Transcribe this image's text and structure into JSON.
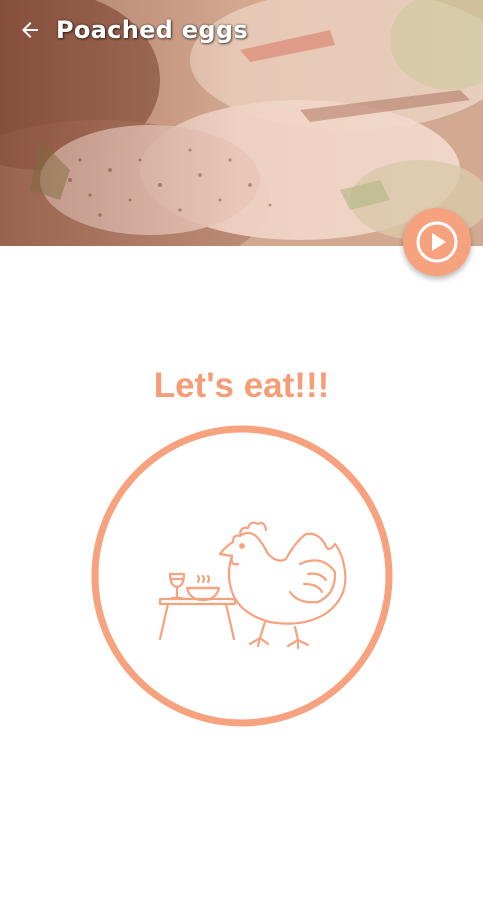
{
  "header": {
    "title": "Poached eggs",
    "back_icon": "arrow-left-icon",
    "play_icon": "play-circle-icon"
  },
  "main": {
    "heading": "Let's eat!!!",
    "illustration_icon": "hen-dining-icon"
  },
  "colors": {
    "accent": "#f59d77",
    "fab": "#f7a27e",
    "background": "#ffffff"
  }
}
